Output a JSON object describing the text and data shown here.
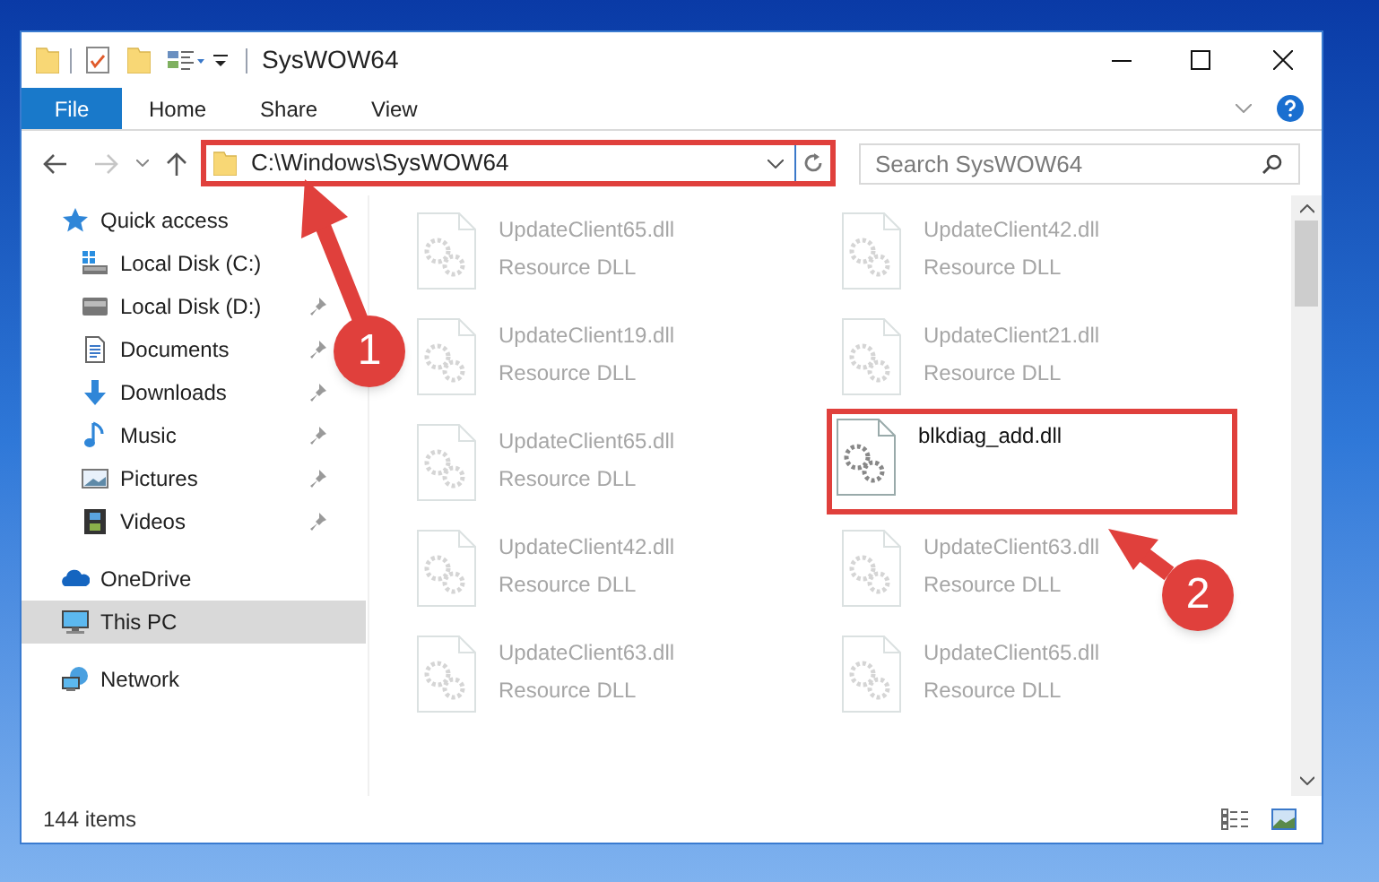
{
  "window": {
    "title": "SysWOW64"
  },
  "ribbon_tabs": [
    {
      "label": "File",
      "kind": "file"
    },
    {
      "label": "Home",
      "kind": "tab"
    },
    {
      "label": "Share",
      "kind": "tab"
    },
    {
      "label": "View",
      "kind": "tab"
    }
  ],
  "address_bar": {
    "path": "C:\\Windows\\SysWOW64",
    "highlighted": true
  },
  "search": {
    "placeholder": "Search SysWOW64"
  },
  "navigation": [
    {
      "label": "Quick access",
      "kind": "star",
      "selected": false,
      "pinned": false,
      "children": [
        {
          "label": "Local Disk (C:)",
          "kind": "system-drive",
          "selected": false,
          "pinned": false
        },
        {
          "label": "Local Disk (D:)",
          "kind": "drive",
          "selected": false,
          "pinned": true
        },
        {
          "label": "Documents",
          "kind": "documents",
          "selected": false,
          "pinned": true
        },
        {
          "label": "Downloads",
          "kind": "downloads",
          "selected": false,
          "pinned": true
        },
        {
          "label": "Music",
          "kind": "music",
          "selected": false,
          "pinned": true
        },
        {
          "label": "Pictures",
          "kind": "pictures",
          "selected": false,
          "pinned": true
        },
        {
          "label": "Videos",
          "kind": "videos",
          "selected": false,
          "pinned": true
        }
      ]
    },
    {
      "label": "OneDrive",
      "kind": "cloud",
      "selected": false,
      "pinned": false
    },
    {
      "label": "This PC",
      "kind": "pc",
      "selected": true,
      "pinned": false
    },
    {
      "label": "Network",
      "kind": "network",
      "selected": false,
      "pinned": false
    }
  ],
  "files": [
    {
      "name": "UpdateClient65.dll",
      "type": "Resource DLL",
      "faded": true,
      "highlighted": false
    },
    {
      "name": "UpdateClient42.dll",
      "type": "Resource DLL",
      "faded": true,
      "highlighted": false
    },
    {
      "name": "UpdateClient19.dll",
      "type": "Resource DLL",
      "faded": true,
      "highlighted": false
    },
    {
      "name": "UpdateClient21.dll",
      "type": "Resource DLL",
      "faded": true,
      "highlighted": false
    },
    {
      "name": "UpdateClient65.dll",
      "type": "Resource DLL",
      "faded": true,
      "highlighted": false
    },
    {
      "name": "blkdiag_add.dll",
      "faded": false,
      "highlighted": true
    },
    {
      "name": "UpdateClient42.dll",
      "type": "Resource DLL",
      "faded": true,
      "highlighted": false
    },
    {
      "name": "UpdateClient63.dll",
      "type": "Resource DLL",
      "faded": true,
      "highlighted": false
    },
    {
      "name": "UpdateClient63.dll",
      "type": "Resource DLL",
      "faded": true,
      "highlighted": false
    },
    {
      "name": "UpdateClient65.dll",
      "type": "Resource DLL",
      "faded": true,
      "highlighted": false
    }
  ],
  "status_bar": {
    "item_count": "144 items"
  },
  "annotations": [
    {
      "label": "1"
    },
    {
      "label": "2"
    }
  ]
}
